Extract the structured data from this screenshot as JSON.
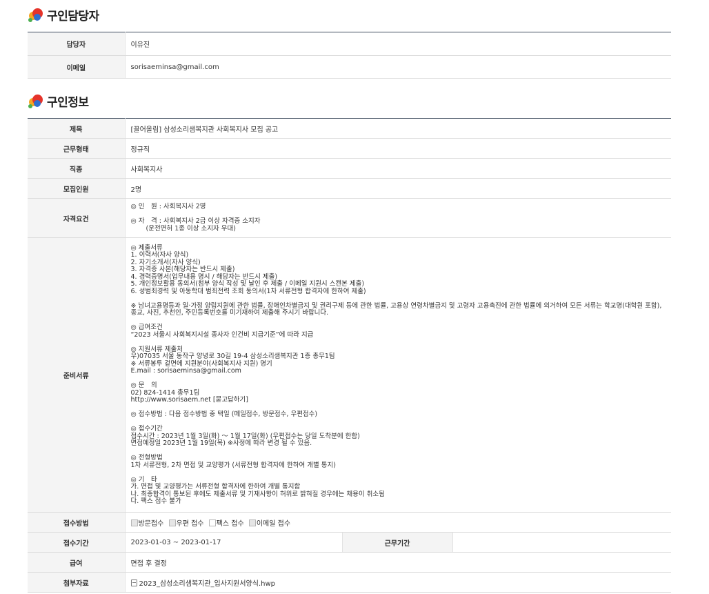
{
  "manager_section": {
    "title": "구인담당자",
    "rows": [
      {
        "label": "담당자",
        "value": "이유진"
      },
      {
        "label": "이메일",
        "value": "sorisaeminsa@gmail.com"
      }
    ]
  },
  "info_section": {
    "title": "구인정보",
    "title_row": {
      "label": "제목",
      "value": "[끌어올림] 삼성소리샘복지관 사회복지사 모집 공고"
    },
    "work_type": {
      "label": "근무형태",
      "value": "정규직"
    },
    "job_type": {
      "label": "직종",
      "value": "사회복지사"
    },
    "headcount": {
      "label": "모집인원",
      "value": "2명"
    },
    "qualifications": {
      "label": "자격요건",
      "text": "◎ 인　원 : 사회복지사 2명\n\n◎ 자　격 : 사회복지사 2급 이상 자격증 소지자\n　　 (운전면허 1종 이상 소지자 우대)"
    },
    "documents": {
      "label": "준비서류",
      "text": "◎ 제출서류\n1. 이력서(자사 양식)\n2. 자기소개서(자사 양식)\n3. 자격증 사본(해당자는 반드시 제출)\n4. 경력증명서(업무내용 명시 / 해당자는 반드시 제출)\n5. 개인정보활용 동의서(첨부 양식 작성 및 날인 후 제출 / 이메일 지원시 스캔본 제출)\n6. 성범죄경력 및 아동학대 범죄전력 조회 동의서(1차 서류전형 합격자에 한하여 제출)\n\n※ 남녀고용평등과 일·가정 양립지원에 관한 법률, 장애인차별금지 및 권리구제 등에 관한 법률, 고용상 연령차별금지 및 고령자 고용촉진에 관한 법률에 의거하여 모든 서류는 학교명(대학원 포함), 종교, 사진, 추천인, 주민등록번호를 미기재하여 제출해 주시기 바랍니다.\n\n◎ 급여조건\n“2023 서울시 사회복지시설 종사자 인건비 지급기준”에 따라 지급\n\n◎ 지원서류 제출처\n우)07035 서울 동작구 양녕로 30길 19-4 삼성소리샘복지관 1층 총무1팀\n※ 서류봉투 겉면에 지원분야(사회복지사 지원) 명기\nE.mail : sorisaeminsa@gmail.com\n\n◎ 문　의\n02) 824-1414 총무1팀\nhttp://www.sorisaem.net [묻고답하기]\n\n◎ 접수방법 : 다음 접수방법 중 택일 (메일접수, 방문접수, 우편접수)\n\n◎ 접수기간\n접수시간 : 2023년 1월 3일(화) ～ 1월 17일(화) (우편접수는 당일 도착분에 한함)\n면접예정일 2023년 1월 19일(목) ※사정에 따라 변경 될 수 있음.\n\n◎ 전형방법\n1차 서류전형, 2차 면접 및 교양평가 (서류전형 합격자에 한하여 개별 통지)\n\n◎ 기　타\n가. 면접 및 교양평가는 서류전형 합격자에 한하여 개별 통지함\n나. 최종합격이 통보된 후에도 제출서류 및 기재사항이 허위로 밝혀질 경우에는 채용이 취소됨\n다. 팩스 접수 불가"
    },
    "apply_methods": {
      "label": "접수방법",
      "options": [
        {
          "label": "방문접수",
          "checked": true
        },
        {
          "label": "우편 접수",
          "checked": true
        },
        {
          "label": "팩스 접수",
          "checked": false
        },
        {
          "label": "이메일 접수",
          "checked": true
        }
      ]
    },
    "apply_period": {
      "label": "접수기간",
      "value": "2023-01-03 ~ 2023-01-17",
      "work_period_label": "근무기간",
      "work_period_value": ""
    },
    "salary": {
      "label": "급여",
      "value": "면접 후 결정"
    },
    "attachment": {
      "label": "첨부자료",
      "file_name": "2023_삼성소리샘복지관_입사지원서양식.hwp"
    }
  }
}
